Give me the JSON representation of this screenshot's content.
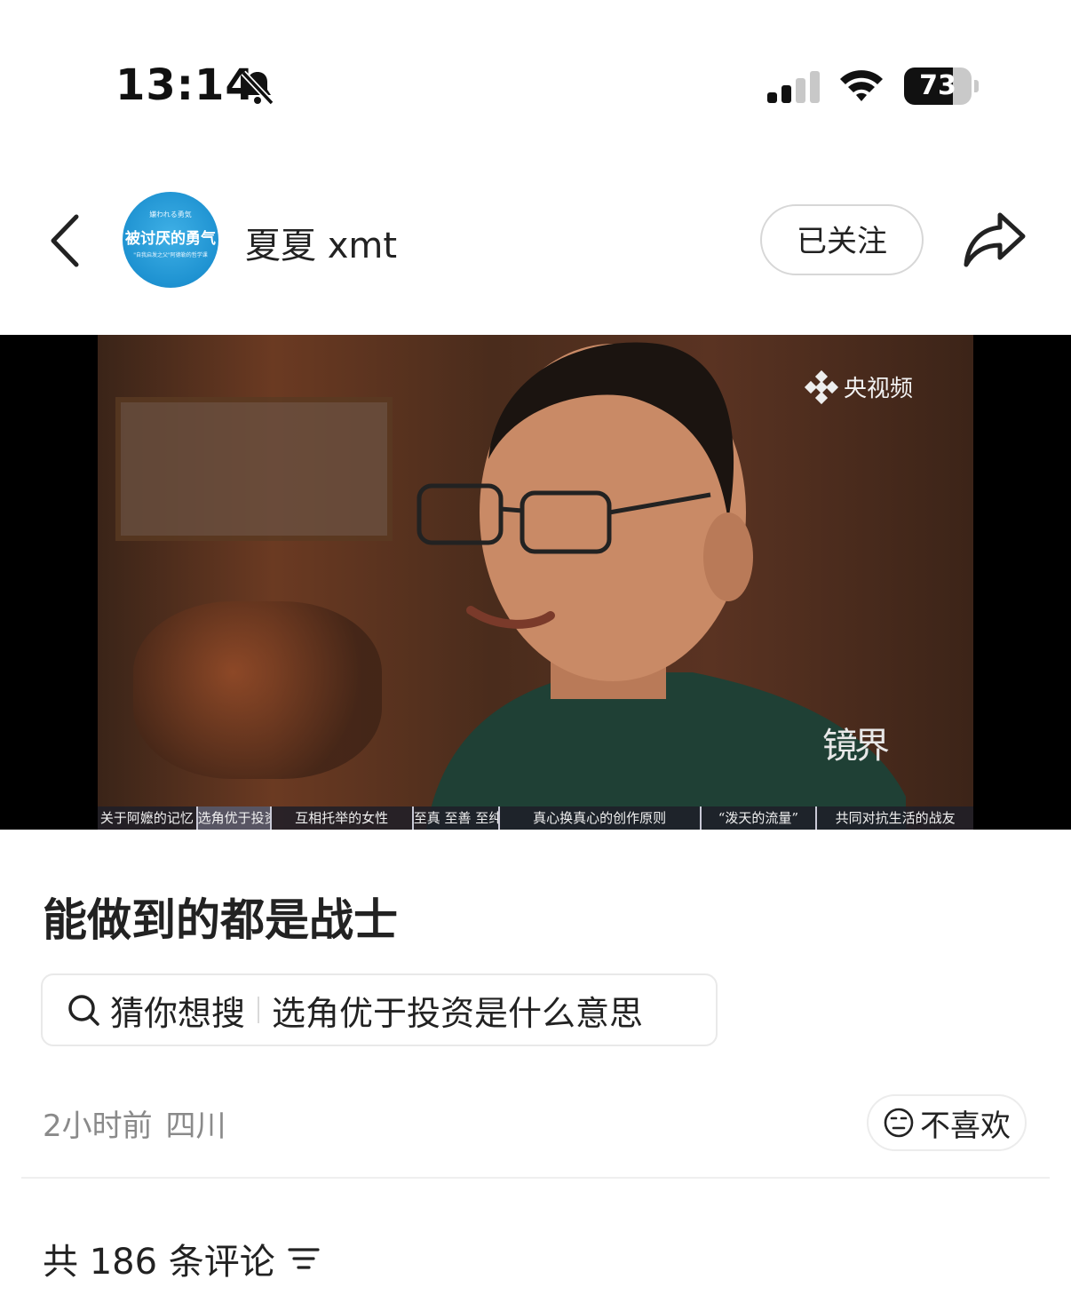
{
  "status_bar": {
    "time": "13:14",
    "battery_percent": "73",
    "battery_level": 0.73,
    "icons": [
      "bell-slash-icon",
      "cellular-signal-icon",
      "wifi-icon",
      "battery-icon"
    ]
  },
  "header": {
    "back_icon": "chevron-left-icon",
    "avatar": {
      "small_top": "嫌われる勇気",
      "title": "被讨厌的勇气",
      "subtitle": "\"自我启发之父\"阿德勒的哲学课"
    },
    "username": "夏夏 xmt",
    "follow_label": "已关注",
    "share_icon": "share-arrow-icon"
  },
  "video": {
    "watermark": "央视频",
    "program_logo": "镜界",
    "chapters": [
      "关于阿嬷的记忆",
      "选角优于投资",
      "互相托举的女性",
      "至真 至善 至纯",
      "真心换真心的创作原则",
      "“泼天的流量”",
      "共同对抗生活的战友"
    ],
    "active_chapter_index": 1
  },
  "post": {
    "title": "能做到的都是战士",
    "suggest_label": "猜你想搜",
    "suggest_query": "选角优于投资是什么意思",
    "time_ago": "2小时前",
    "location": "四川",
    "dislike_label": "不喜欢"
  },
  "comments": {
    "summary": "共 186 条评论"
  },
  "colors": {
    "text_primary": "#222222",
    "text_secondary": "#8a8a8a",
    "avatar_blue": "#1e92d1",
    "border": "#e9e9e9"
  }
}
